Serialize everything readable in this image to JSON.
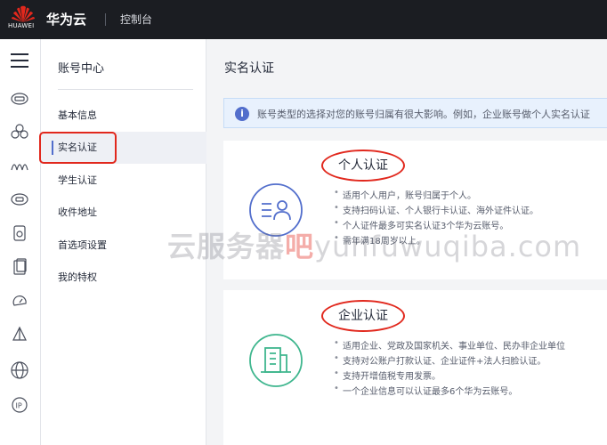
{
  "header": {
    "logo_text": "HUAWEI",
    "brand": "华为云",
    "console_label": "控制台"
  },
  "rail": {
    "icons": [
      "menu-icon",
      "cloud-server-icon",
      "cluster-icon",
      "wave-icon",
      "database-icon",
      "storage-icon",
      "document-icon",
      "cloud-gauge-icon",
      "sail-icon",
      "globe-icon",
      "ip-icon"
    ]
  },
  "sidebar": {
    "title": "账号中心",
    "items": [
      {
        "label": "基本信息"
      },
      {
        "label": "实名认证"
      },
      {
        "label": "学生认证"
      },
      {
        "label": "收件地址"
      },
      {
        "label": "首选项设置"
      },
      {
        "label": "我的特权"
      }
    ]
  },
  "main": {
    "title": "实名认证",
    "info": "账号类型的选择对您的账号归属有很大影响。例如，企业账号做个人实名认证",
    "cards": [
      {
        "title": "个人认证",
        "icon": "personal-id-icon",
        "features": [
          "适用个人用户，账号归属于个人。",
          "支持扫码认证、个人银行卡认证、海外证件认证。",
          "个人证件最多可实名认证3个华为云账号。",
          "需年满18周岁以上。"
        ]
      },
      {
        "title": "企业认证",
        "icon": "enterprise-building-icon",
        "features": [
          "适用企业、党政及国家机关、事业单位、民办非企业单位",
          "支持对公账户打款认证、企业证件+法人扫脸认证。",
          "支持开增值税专用发票。",
          "一个企业信息可以认证最多6个华为云账号。"
        ]
      }
    ]
  },
  "watermark": {
    "part1": "云服务器",
    "part2": "吧",
    "part3": "yunfuwuqiba.com"
  },
  "colors": {
    "topbar": "#1b1d22",
    "highlight_red": "#e1281d",
    "accent_blue": "#526ecc",
    "enterprise_green": "#3fb68e"
  }
}
